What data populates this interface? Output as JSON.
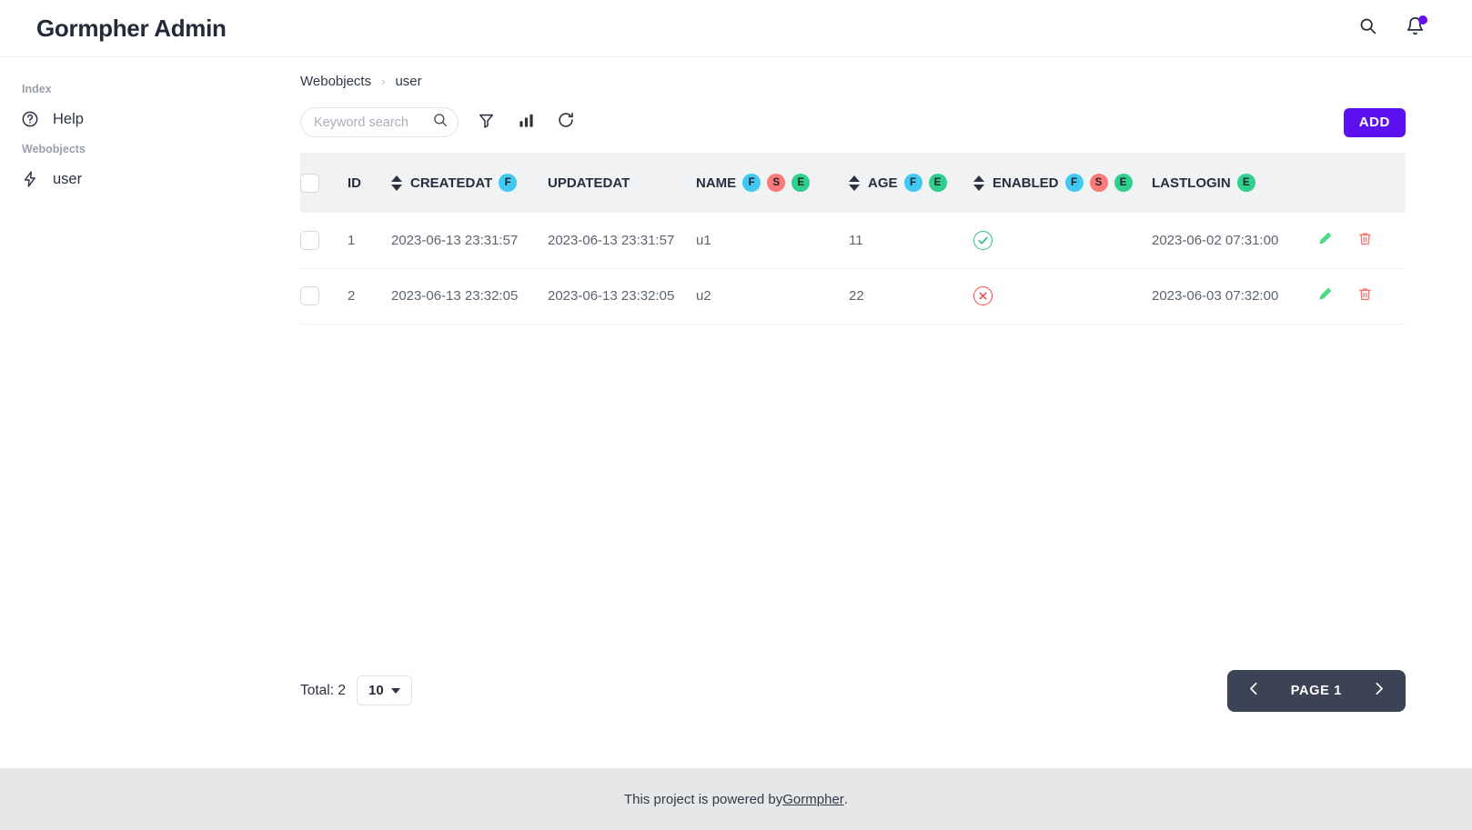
{
  "header": {
    "brand": "Gormpher Admin",
    "search_icon": "search-icon",
    "bell_icon": "bell-icon",
    "has_notification": true,
    "notification_color": "#6610f2"
  },
  "sidebar": {
    "groups": [
      {
        "label": "Index",
        "items": [
          {
            "label": "Help",
            "icon": "question-circle-icon"
          }
        ]
      },
      {
        "label": "Webobjects",
        "items": [
          {
            "label": "user",
            "icon": "lightning-bolt-icon"
          }
        ]
      }
    ]
  },
  "breadcrumb": {
    "root": "Webobjects",
    "separator": "›",
    "current": "user"
  },
  "toolbar": {
    "search_placeholder": "Keyword search",
    "search_value": "",
    "filter_icon": "filter-icon",
    "chart_icon": "bar-chart-icon",
    "refresh_icon": "refresh-icon",
    "add_label": "ADD",
    "add_color": "#5b11f0"
  },
  "table": {
    "columns": [
      {
        "key": "check",
        "label": "",
        "sortable": false,
        "badges": []
      },
      {
        "key": "id",
        "label": "ID",
        "sortable": false,
        "badges": []
      },
      {
        "key": "createdat",
        "label": "CREATEDAT",
        "sortable": true,
        "badges": [
          "F"
        ]
      },
      {
        "key": "updatedat",
        "label": "UPDATEDAT",
        "sortable": false,
        "badges": []
      },
      {
        "key": "name",
        "label": "NAME",
        "sortable": false,
        "badges": [
          "F",
          "S",
          "E"
        ]
      },
      {
        "key": "age",
        "label": "AGE",
        "sortable": true,
        "badges": [
          "F",
          "E"
        ]
      },
      {
        "key": "enabled",
        "label": "ENABLED",
        "sortable": true,
        "badges": [
          "F",
          "S",
          "E"
        ]
      },
      {
        "key": "lastlogin",
        "label": "LASTLOGIN",
        "sortable": false,
        "badges": [
          "E"
        ]
      },
      {
        "key": "actions",
        "label": "",
        "sortable": false,
        "badges": []
      }
    ],
    "badge_colors": {
      "F": "#3ec8f2",
      "S": "#f97a77",
      "E": "#2fcf8d"
    },
    "rows": [
      {
        "id": "1",
        "createdat": "2023-06-13 23:31:57",
        "updatedat": "2023-06-13 23:31:57",
        "name": "u1",
        "age": "11",
        "enabled": true,
        "lastlogin": "2023-06-02 07:31:00",
        "edit_icon": "pencil-icon",
        "delete_icon": "trash-icon"
      },
      {
        "id": "2",
        "createdat": "2023-06-13 23:32:05",
        "updatedat": "2023-06-13 23:32:05",
        "name": "u2",
        "age": "22",
        "enabled": false,
        "lastlogin": "2023-06-03 07:32:00",
        "edit_icon": "pencil-icon",
        "delete_icon": "trash-icon"
      }
    ]
  },
  "pagination": {
    "total_label": "Total: 2",
    "page_size": "10",
    "page_label": "PAGE 1",
    "prev_icon": "chevron-left-icon",
    "next_icon": "chevron-right-icon"
  },
  "footer": {
    "text_before": "This project is powered by ",
    "link": "Gormpher ",
    "text_after": "."
  }
}
